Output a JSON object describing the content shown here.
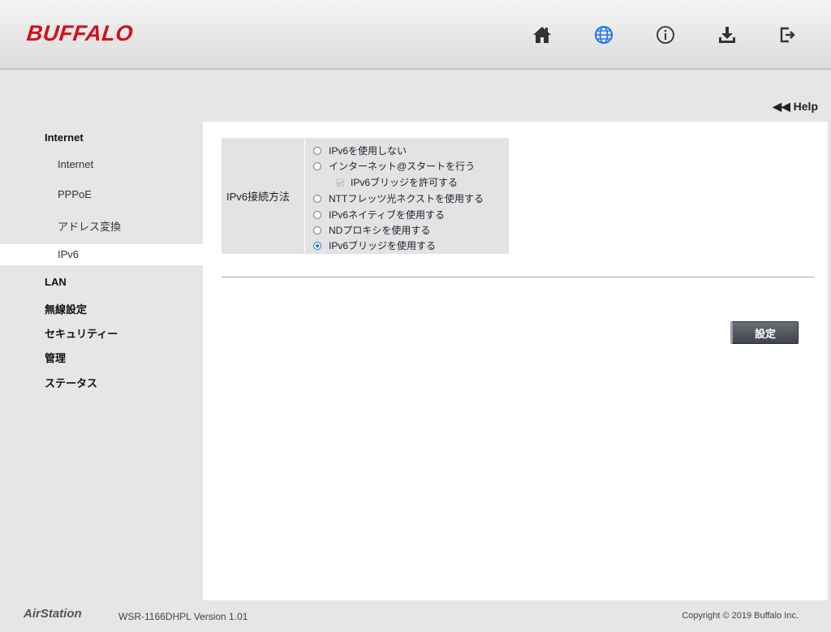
{
  "header": {
    "logo": "BUFFALO",
    "icons": [
      "home-icon",
      "globe-icon",
      "info-icon",
      "download-icon",
      "logout-icon"
    ]
  },
  "help": {
    "label": "◀◀ Help"
  },
  "sidebar": {
    "groups": [
      {
        "label": "Internet",
        "items": [
          "Internet",
          "PPPoE",
          "アドレス変換",
          "IPv6"
        ]
      },
      {
        "label": "LAN"
      },
      {
        "label": "無線設定"
      },
      {
        "label": "セキュリティー"
      },
      {
        "label": "管理"
      },
      {
        "label": "ステータス"
      }
    ],
    "active_item": "IPv6"
  },
  "form": {
    "field_label": "IPv6接続方法",
    "options": [
      {
        "label": "IPv6を使用しない",
        "type": "radio",
        "checked": false
      },
      {
        "label": "インターネット@スタートを行う",
        "type": "radio",
        "checked": false
      },
      {
        "label": "IPv6ブリッジを許可する",
        "type": "checkbox",
        "checked": true,
        "disabled": true
      },
      {
        "label": "NTTフレッツ光ネクストを使用する",
        "type": "radio",
        "checked": false
      },
      {
        "label": "IPv6ネイティブを使用する",
        "type": "radio",
        "checked": false
      },
      {
        "label": "NDプロキシを使用する",
        "type": "radio",
        "checked": false
      },
      {
        "label": "IPv6ブリッジを使用する",
        "type": "radio",
        "checked": true
      }
    ],
    "submit_label": "設定"
  },
  "footer": {
    "brand": "AirStation",
    "model": "WSR-1166DHPL Version 1.01",
    "copyright": "Copyright © 2019 Buffalo Inc."
  },
  "colors": {
    "brand_red": "#d0111b",
    "accent_blue": "#1a73e8",
    "icon_dark": "#333333"
  }
}
